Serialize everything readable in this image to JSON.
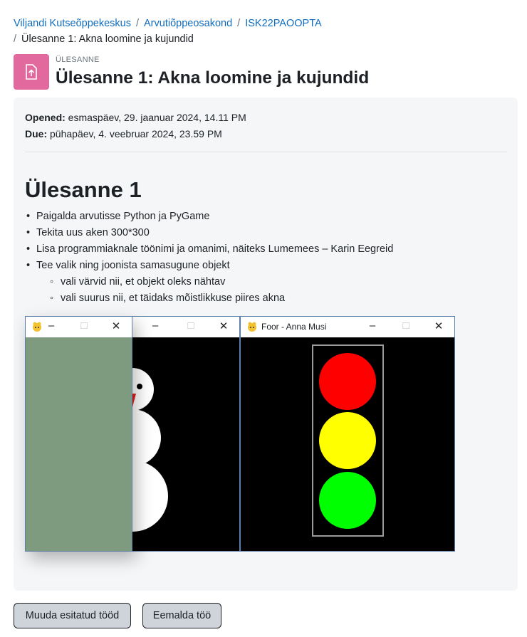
{
  "breadcrumb": {
    "items": [
      "Viljandi Kutseõppekeskus",
      "Arvutiõppeosakond",
      "ISK22PAOOPTA"
    ],
    "separator": "/",
    "current": "Ülesanne 1: Akna loomine ja kujundid"
  },
  "header": {
    "eyebrow": "ÜLESANNE",
    "title": "Ülesanne 1: Akna loomine ja kujundid",
    "icon": "assignment-upload-icon",
    "icon_color": "#e2699e"
  },
  "dates": {
    "opened_label": "Opened:",
    "opened_value": "esmaspäev, 29. jaanuar 2024, 14.11 PM",
    "due_label": "Due:",
    "due_value": "pühapäev, 4. veebruar 2024, 23.59 PM"
  },
  "content": {
    "heading": "Ülesanne 1",
    "bullets": [
      "Paigalda arvutisse Python ja PyGame",
      "Tekita uus aken 300*300",
      "Lisa programmiaknale töönimi ja omanimi, näiteks Lumemees – Karin Eegreid",
      "Tee valik ning joonista samasugune objekt"
    ],
    "sub_bullets": [
      "vali värvid nii, et objekt oleks nähtav",
      "vali suurus nii, et täidaks mõistlikkuse piires akna"
    ]
  },
  "screens": {
    "traffic_light_window_title": "Foor - Anna Musi",
    "window_controls": [
      "–",
      "□",
      "✕"
    ],
    "colors": {
      "overlay": "#7f9b7f",
      "red": "#ff0000",
      "yellow": "#ffff00",
      "green": "#00ff00",
      "snowman": "#ffffff",
      "nose": "#e02020"
    }
  },
  "actions": {
    "edit_submission": "Muuda esitatud tööd",
    "remove_submission": "Eemalda töö"
  }
}
